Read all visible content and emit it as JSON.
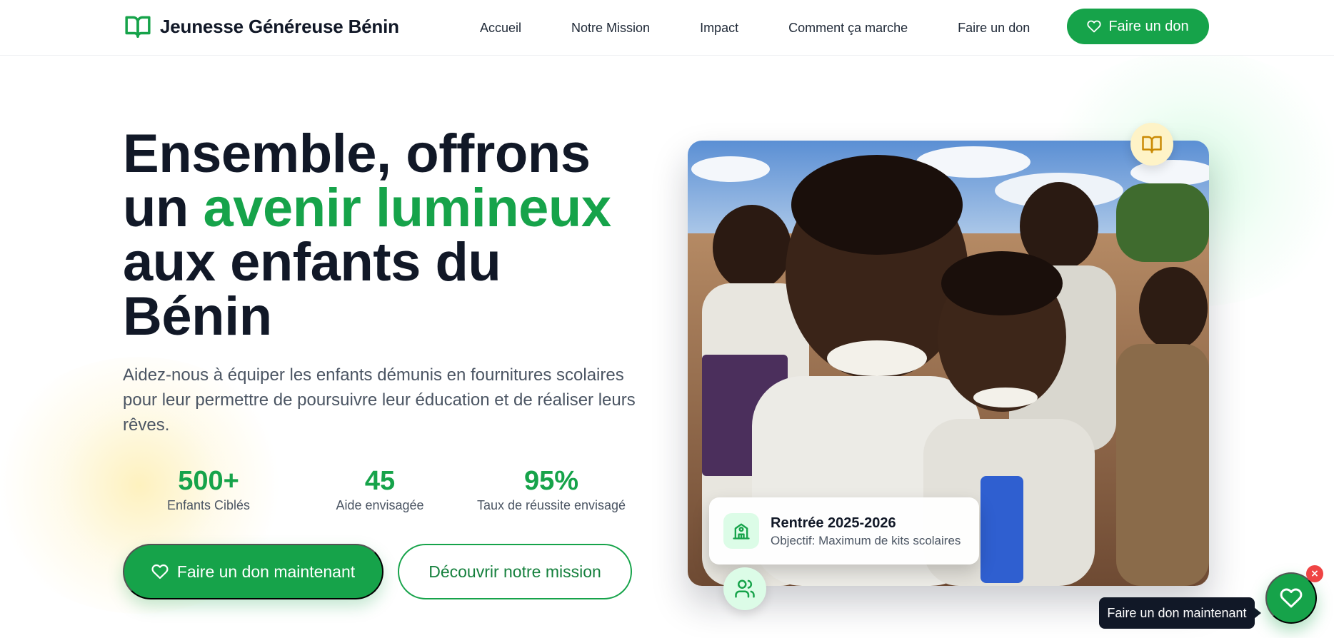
{
  "header": {
    "brand_name": "Jeunesse Généreuse Bénin",
    "nav": [
      "Accueil",
      "Notre Mission",
      "Impact",
      "Comment ça marche",
      "Faire un don"
    ],
    "cta_label": "Faire un don"
  },
  "hero": {
    "title_part1": "Ensemble, offrons",
    "title_part2": "un ",
    "title_accent": "avenir lumineux",
    "title_part3": "aux enfants du",
    "title_part4": "Bénin",
    "subtitle": "Aidez-nous à équiper les enfants démunis en fournitures scolaires pour leur permettre de poursuivre leur éducation et de réaliser leurs rêves.",
    "stats": [
      {
        "value": "500+",
        "label": "Enfants Ciblés"
      },
      {
        "value": "45",
        "label": "Aide envisagée"
      },
      {
        "value": "95%",
        "label": "Taux de réussite envisagé"
      }
    ],
    "primary_button": "Faire un don maintenant",
    "secondary_button": "Découvrir notre mission"
  },
  "image_card": {
    "title": "Rentrée 2025-2026",
    "subtitle": "Objectif: Maximum de kits scolaires"
  },
  "floating": {
    "tooltip": "Faire un don maintenant",
    "close_symbol": "×"
  },
  "icons": {
    "brand": "book-open-icon",
    "heart": "heart-icon",
    "book_badge": "book-open-icon",
    "school": "school-icon",
    "users": "users-icon"
  },
  "colors": {
    "primary": "#16a34a",
    "text": "#111827",
    "muted": "#4b5563",
    "accent_yellow": "#fef3c7",
    "close_red": "#ef4444"
  }
}
